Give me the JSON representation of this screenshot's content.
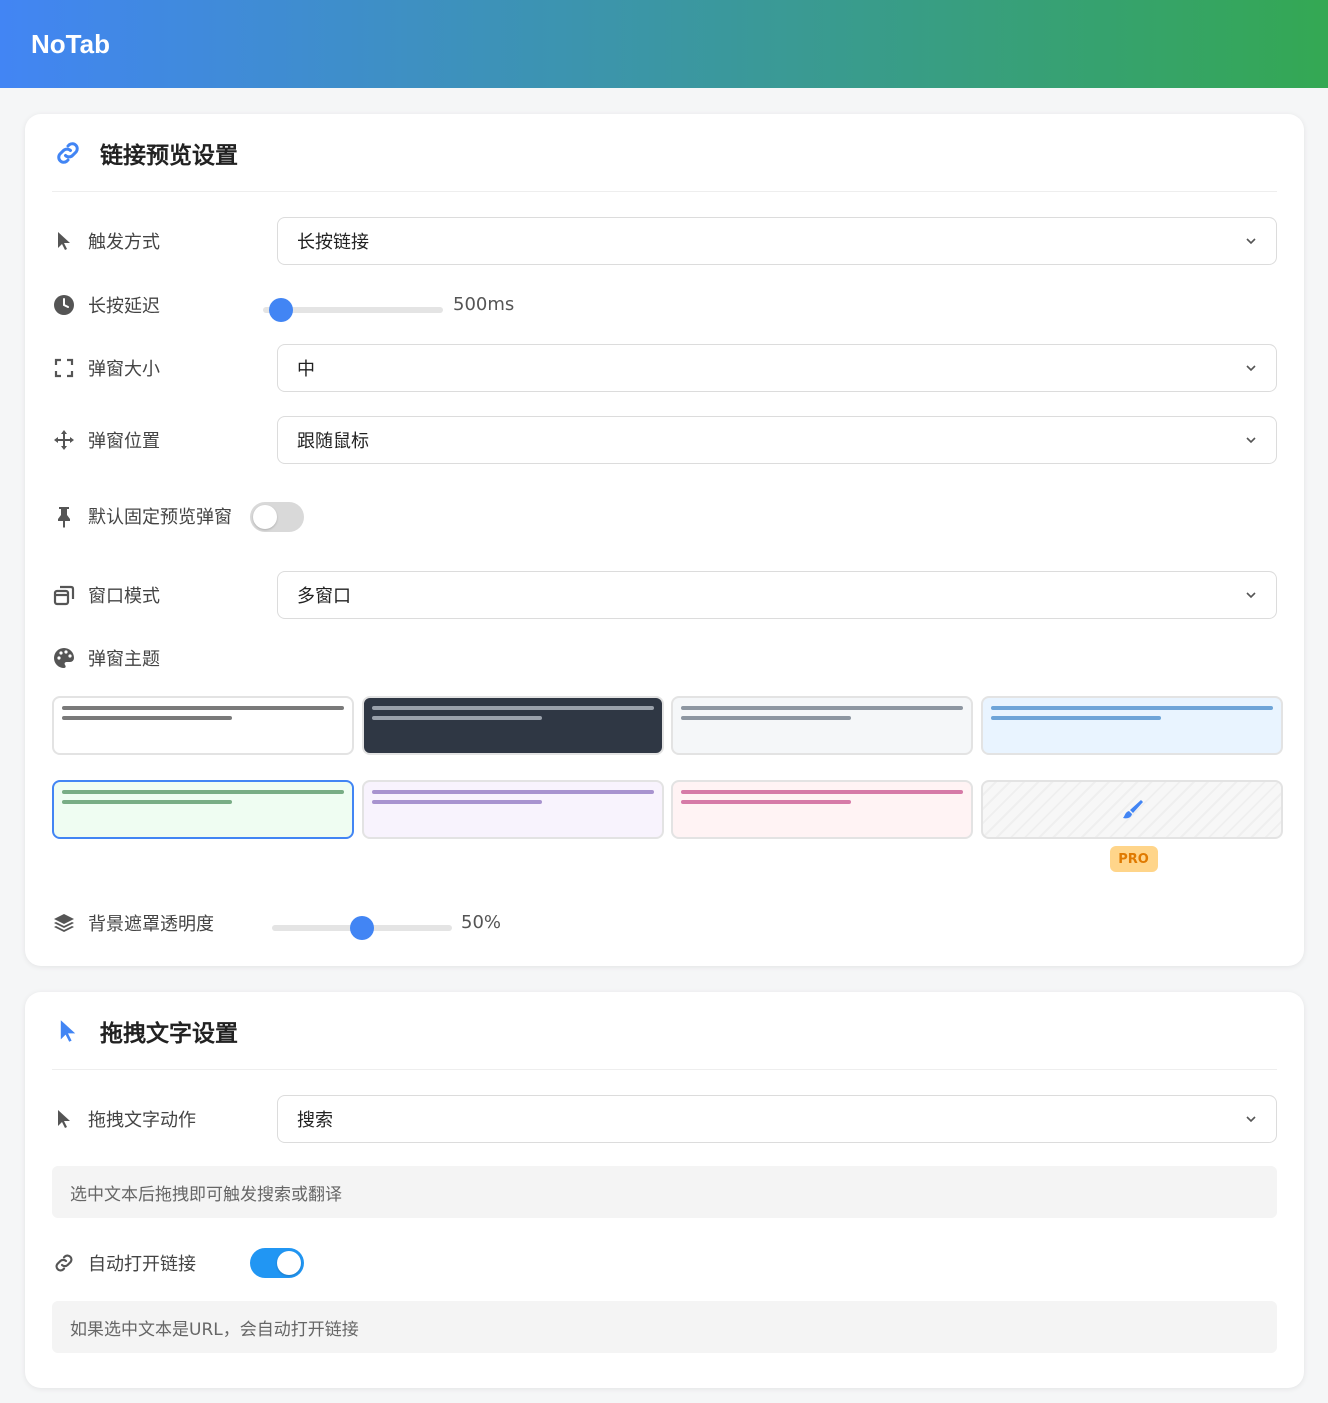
{
  "app": {
    "title": "NoTab"
  },
  "preview": {
    "title": "链接预览设置",
    "trigger": {
      "label": "触发方式",
      "value": "长按链接"
    },
    "delay": {
      "label": "长按延迟",
      "value_text": "500ms",
      "value_fraction": 0.1
    },
    "size": {
      "label": "弹窗大小",
      "value": "中"
    },
    "position": {
      "label": "弹窗位置",
      "value": "跟随鼠标"
    },
    "pin": {
      "label": "默认固定预览弹窗",
      "on": false
    },
    "window_mode": {
      "label": "窗口模式",
      "value": "多窗口"
    },
    "theme": {
      "label": "弹窗主题",
      "options": [
        {
          "name": "light",
          "bg": "#ffffff",
          "line": "#7a7a7a"
        },
        {
          "name": "dark",
          "bg": "#2f3744",
          "line": "#9aa1ab"
        },
        {
          "name": "gray",
          "bg": "#f5f7f9",
          "line": "#8d96a1"
        },
        {
          "name": "blue",
          "bg": "#e9f4ff",
          "line": "#6ea4d8"
        },
        {
          "name": "green",
          "bg": "#effdf2",
          "line": "#78ad85",
          "selected": true
        },
        {
          "name": "purple",
          "bg": "#f8f3fd",
          "line": "#a893cf"
        },
        {
          "name": "pink",
          "bg": "#fff3f4",
          "line": "#d67aa7"
        },
        {
          "name": "custom",
          "bg": "#f8f8f8",
          "line": "",
          "badge": "PRO"
        }
      ]
    },
    "overlay": {
      "label": "背景遮罩透明度",
      "value_text": "50%",
      "value_fraction": 0.5
    }
  },
  "drag": {
    "title": "拖拽文字设置",
    "action": {
      "label": "拖拽文字动作",
      "value": "搜索"
    },
    "action_hint": "选中文本后拖拽即可触发搜索或翻译",
    "auto_open": {
      "label": "自动打开链接",
      "on": true
    },
    "auto_open_hint": "如果选中文本是URL，会自动打开链接"
  },
  "colors": {
    "accent": "#4285f4",
    "toggle_on": "#2196f3",
    "toggle_off": "#d9d9d9",
    "pro_text": "#e07a00"
  }
}
